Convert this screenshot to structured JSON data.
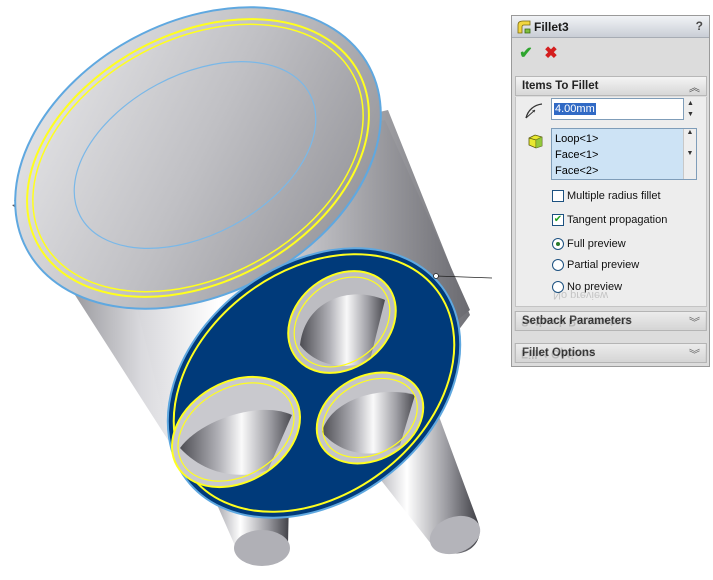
{
  "feature_panel": {
    "title": "Fillet3",
    "help_glyph": "?",
    "ok_icon": "check-icon",
    "cancel_icon": "x-icon",
    "items_to_fillet": {
      "header": "Items To Fillet",
      "radius_value": "4.00mm",
      "selection": [
        "Loop<1>",
        "Face<1>",
        "Face<2>"
      ],
      "multiple_radius_label": "Multiple radius fillet",
      "multiple_radius_checked": false,
      "tangent_label": "Tangent propagation",
      "tangent_checked": true,
      "preview_options": [
        "Full preview",
        "Partial preview",
        "No preview"
      ],
      "preview_selected": "Full preview"
    },
    "setback_header": "Setback Parameters",
    "options_header": "Fillet Options",
    "colors": {
      "face_selection": "#003a7a",
      "edge_highlight": "#ffff1e",
      "edge_outline": "#5fa8e0",
      "ok": "#2ea52e",
      "cancel": "#d41e1e"
    }
  }
}
